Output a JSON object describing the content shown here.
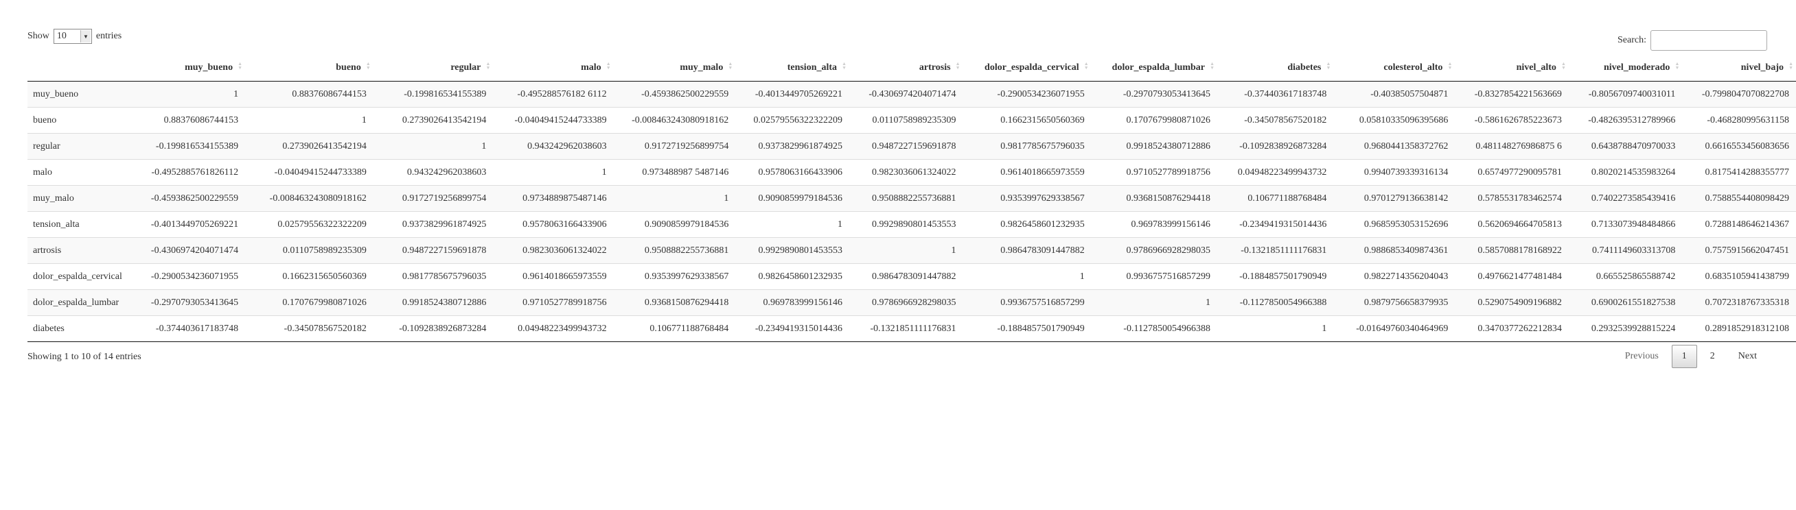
{
  "length_menu": {
    "label_before": "Show",
    "value": "10",
    "label_after": "entries"
  },
  "search": {
    "label": "Search:",
    "value": ""
  },
  "table": {
    "columns": [
      "",
      "muy_bueno",
      "bueno",
      "regular",
      "malo",
      "muy_malo",
      "tension_alta",
      "artrosis",
      "dolor_espalda_cervical",
      "dolor_espalda_lumbar",
      "diabetes",
      "colesterol_alto",
      "nivel_alto",
      "nivel_moderado",
      "nivel_bajo"
    ],
    "rows": [
      [
        "muy_bueno",
        "1",
        "0.88376086744153",
        "-0.199816534155389",
        "-0.495288576182 6112",
        "-0.4593862500229559",
        "-0.4013449705269221",
        "-0.4306974204071474",
        "-0.2900534236071955",
        "-0.2970793053413645",
        "-0.374403617183748",
        "-0.40385057504871",
        "-0.8327854221563669",
        "-0.8056709740031011",
        "-0.7998047070822708"
      ],
      [
        "bueno",
        "0.88376086744153",
        "1",
        "0.2739026413542194",
        "-0.04049415244733389",
        "-0.008463243080918162",
        "0.02579556322322209",
        "0.0110758989235309",
        "0.1662315650560369",
        "0.1707679980871026",
        "-0.345078567520182",
        "0.05810335096395686",
        "-0.5861626785223673",
        "-0.4826395312789966",
        "-0.468280995631158"
      ],
      [
        "regular",
        "-0.199816534155389",
        "0.2739026413542194",
        "1",
        "0.943242962038603",
        "0.9172719256899754",
        "0.9373829961874925",
        "0.9487227159691878",
        "0.9817785675796035",
        "0.9918524380712886",
        "-0.1092838926873284",
        "0.9680441358372762",
        "0.481148276986875 6",
        "0.6438788470970033",
        "0.6616553456083656"
      ],
      [
        "malo",
        "-0.4952885761826112",
        "-0.04049415244733389",
        "0.943242962038603",
        "1",
        "0.973488987 5487146",
        "0.9578063166433906",
        "0.9823036061324022",
        "0.9614018665973559",
        "0.9710527789918756",
        "0.04948223499943732",
        "0.9940739339316134",
        "0.6574977290095781",
        "0.8020214535983264",
        "0.8175414288355777"
      ],
      [
        "muy_malo",
        "-0.4593862500229559",
        "-0.008463243080918162",
        "0.9172719256899754",
        "0.9734889875487146",
        "1",
        "0.9090859979184536",
        "0.9508882255736881",
        "0.9353997629338567",
        "0.9368150876294418",
        "0.106771188768484",
        "0.9701279136638142",
        "0.5785531783462574",
        "0.7402273585439416",
        "0.7588554408098429"
      ],
      [
        "tension_alta",
        "-0.4013449705269221",
        "0.02579556322322209",
        "0.9373829961874925",
        "0.9578063166433906",
        "0.9090859979184536",
        "1",
        "0.9929890801453553",
        "0.9826458601232935",
        "0.969783999156146",
        "-0.2349419315014436",
        "0.9685953053152696",
        "0.5620694664705813",
        "0.7133073948484866",
        "0.7288148646214367"
      ],
      [
        "artrosis",
        "-0.4306974204071474",
        "0.0110758989235309",
        "0.9487227159691878",
        "0.9823036061324022",
        "0.9508882255736881",
        "0.9929890801453553",
        "1",
        "0.9864783091447882",
        "0.9786966928298035",
        "-0.1321851111176831",
        "0.9886853409874361",
        "0.5857088178168922",
        "0.7411149603313708",
        "0.7575915662047451"
      ],
      [
        "dolor_espalda_cervical",
        "-0.2900534236071955",
        "0.1662315650560369",
        "0.9817785675796035",
        "0.9614018665973559",
        "0.9353997629338567",
        "0.9826458601232935",
        "0.9864783091447882",
        "1",
        "0.9936757516857299",
        "-0.1884857501790949",
        "0.9822714356204043",
        "0.4976621477481484",
        "0.665525865588742",
        "0.6835105941438799"
      ],
      [
        "dolor_espalda_lumbar",
        "-0.2970793053413645",
        "0.1707679980871026",
        "0.9918524380712886",
        "0.9710527789918756",
        "0.9368150876294418",
        "0.969783999156146",
        "0.9786966928298035",
        "0.9936757516857299",
        "1",
        "-0.1127850054966388",
        "0.9879756658379935",
        "0.5290754909196882",
        "0.6900261551827538",
        "0.7072318767335318"
      ],
      [
        "diabetes",
        "-0.374403617183748",
        "-0.345078567520182",
        "-0.1092838926873284",
        "0.04948223499943732",
        "0.106771188768484",
        "-0.2349419315014436",
        "-0.1321851111176831",
        "-0.1884857501790949",
        "-0.1127850054966388",
        "1",
        "-0.01649760340464969",
        "0.3470377262212834",
        "0.2932539928815224",
        "0.2891852918312108"
      ]
    ]
  },
  "info": "Showing 1 to 10 of 14 entries",
  "pagination": {
    "previous": "Previous",
    "pages": [
      "1",
      "2"
    ],
    "current": "1",
    "next": "Next"
  }
}
